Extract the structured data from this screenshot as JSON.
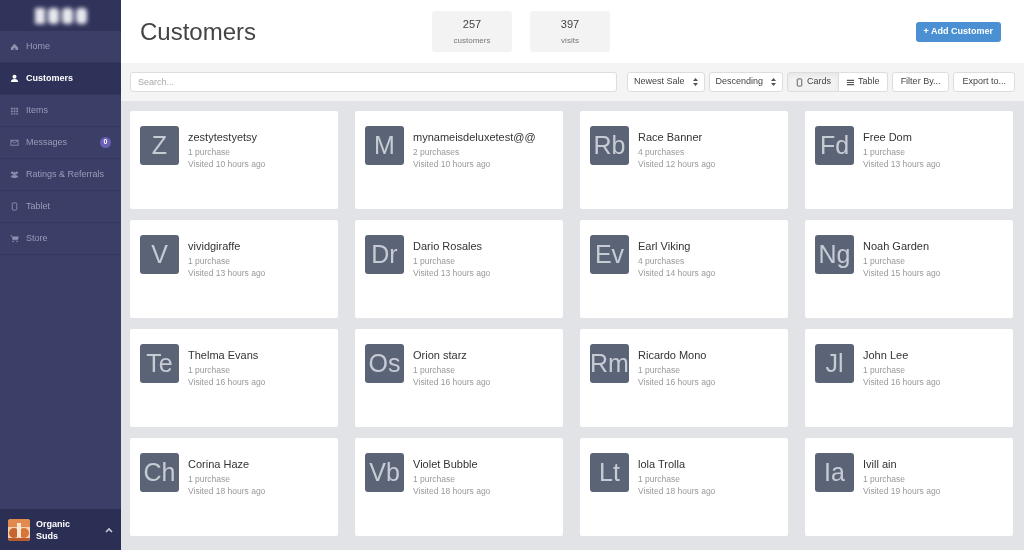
{
  "sidebar": {
    "items": [
      {
        "label": "Home",
        "kind": "home",
        "selected": false
      },
      {
        "label": "Customers",
        "kind": "user",
        "selected": true
      },
      {
        "label": "Items",
        "kind": "grid",
        "selected": false
      },
      {
        "label": "Messages",
        "kind": "mail",
        "selected": false,
        "badge": "0"
      },
      {
        "label": "Ratings & Referrals",
        "kind": "group",
        "selected": false
      },
      {
        "label": "Tablet",
        "kind": "tablet",
        "selected": false
      },
      {
        "label": "Store",
        "kind": "cart",
        "selected": false
      }
    ],
    "account": {
      "name": "Organic Suds"
    }
  },
  "header": {
    "title": "Customers",
    "stats": [
      {
        "value": "257",
        "label": "customers"
      },
      {
        "value": "397",
        "label": "visits"
      }
    ],
    "add_button": "+ Add Customer"
  },
  "toolbar": {
    "search": {
      "placeholder": "Search..."
    },
    "sort": "Newest Sale",
    "order": "Descending",
    "views": [
      {
        "label": "Cards",
        "kind": "tablet",
        "selected": true
      },
      {
        "label": "Table",
        "kind": "list",
        "selected": false
      }
    ],
    "filter": "Filter By...",
    "export": "Export to..."
  },
  "customers": [
    {
      "initials": "Z",
      "name": "zestytestyetsy",
      "purchases": "1 purchase",
      "visited": "Visited 10 hours ago"
    },
    {
      "initials": "M",
      "name": "mynameisdeluxetest@@",
      "purchases": "2 purchases",
      "visited": "Visited 10 hours ago"
    },
    {
      "initials": "Rb",
      "name": "Race Banner",
      "purchases": "4 purchases",
      "visited": "Visited 12 hours ago"
    },
    {
      "initials": "Fd",
      "name": "Free Dom",
      "purchases": "1 purchase",
      "visited": "Visited 13 hours ago"
    },
    {
      "initials": "V",
      "name": "vividgiraffe",
      "purchases": "1 purchase",
      "visited": "Visited 13 hours ago"
    },
    {
      "initials": "Dr",
      "name": "Dario Rosales",
      "purchases": "1 purchase",
      "visited": "Visited 13 hours ago"
    },
    {
      "initials": "Ev",
      "name": "Earl Viking",
      "purchases": "4 purchases",
      "visited": "Visited 14 hours ago"
    },
    {
      "initials": "Ng",
      "name": "Noah Garden",
      "purchases": "1 purchase",
      "visited": "Visited 15 hours ago"
    },
    {
      "initials": "Te",
      "name": "Thelma Evans",
      "purchases": "1 purchase",
      "visited": "Visited 16 hours ago"
    },
    {
      "initials": "Os",
      "name": "Orion starz",
      "purchases": "1 purchase",
      "visited": "Visited 16 hours ago"
    },
    {
      "initials": "Rm",
      "name": "Ricardo Mono",
      "purchases": "1 purchase",
      "visited": "Visited 16 hours ago"
    },
    {
      "initials": "Jl",
      "name": "John Lee",
      "purchases": "1 purchase",
      "visited": "Visited 16 hours ago"
    },
    {
      "initials": "Ch",
      "name": "Corina Haze",
      "purchases": "1 purchase",
      "visited": "Visited 18 hours ago"
    },
    {
      "initials": "Vb",
      "name": "Violet Bubble",
      "purchases": "1 purchase",
      "visited": "Visited 18 hours ago"
    },
    {
      "initials": "Lt",
      "name": "lola Trolla",
      "purchases": "1 purchase",
      "visited": "Visited 18 hours ago"
    },
    {
      "initials": "Ia",
      "name": "Ivill ain",
      "purchases": "1 purchase",
      "visited": "Visited 19 hours ago"
    }
  ]
}
